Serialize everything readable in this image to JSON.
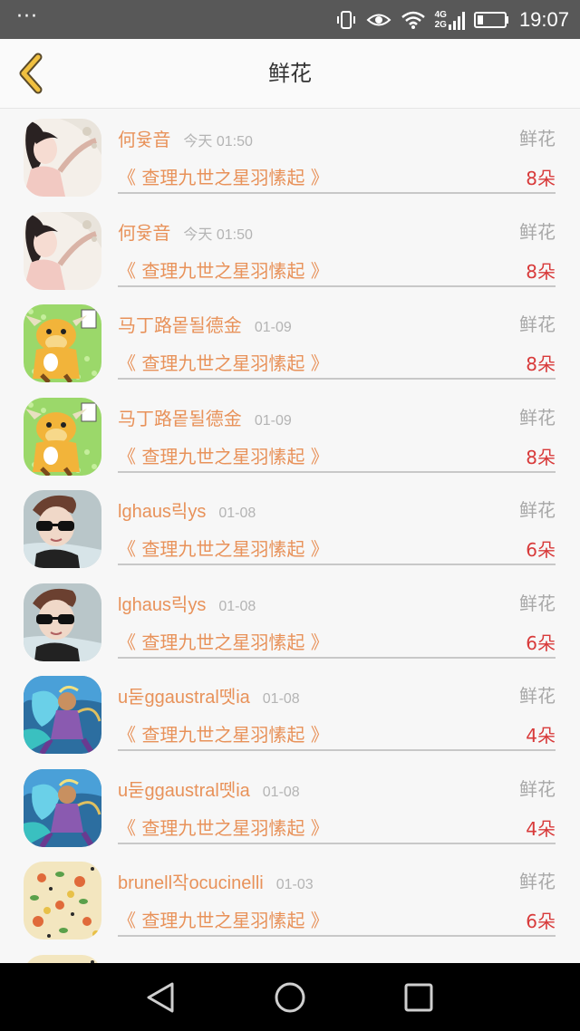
{
  "status_bar": {
    "network": "4G\n2G",
    "time": "19:07"
  },
  "header": {
    "title": "鲜花"
  },
  "items": [
    {
      "name": "何윷音",
      "time": "今天 01:50",
      "category": "鲜花",
      "book": "《 查理九世之星羽愫起 》",
      "count": "8朵",
      "avatar_style": "girl"
    },
    {
      "name": "何윷音",
      "time": "今天 01:50",
      "category": "鲜花",
      "book": "《 查理九世之星羽愫起 》",
      "count": "8朵",
      "avatar_style": "girl"
    },
    {
      "name": "马丁路뫁될德金",
      "time": "01-09",
      "category": "鲜花",
      "book": "《 查理九世之星羽愫起 》",
      "count": "8朵",
      "avatar_style": "bull"
    },
    {
      "name": "马丁路뫁될德金",
      "time": "01-09",
      "category": "鲜花",
      "book": "《 查理九世之星羽愫起 》",
      "count": "8朵",
      "avatar_style": "bull"
    },
    {
      "name": "lghaus릭ys",
      "time": "01-08",
      "category": "鲜花",
      "book": "《 查理九世之星羽愫起 》",
      "count": "6朵",
      "avatar_style": "boy"
    },
    {
      "name": "lghaus릭ys",
      "time": "01-08",
      "category": "鲜花",
      "book": "《 查理九世之星羽愫起 》",
      "count": "6朵",
      "avatar_style": "boy"
    },
    {
      "name": "u둗ggaustral뗏ia",
      "time": "01-08",
      "category": "鲜花",
      "book": "《 查理九世之星羽愫起 》",
      "count": "4朵",
      "avatar_style": "hero"
    },
    {
      "name": "u둗ggaustral뗏ia",
      "time": "01-08",
      "category": "鲜花",
      "book": "《 查理九世之星羽愫起 》",
      "count": "4朵",
      "avatar_style": "hero"
    },
    {
      "name": "brunell작ocucinelli",
      "time": "01-03",
      "category": "鲜花",
      "book": "《 查理九世之星羽愫起 》",
      "count": "6朵",
      "avatar_style": "pizza"
    },
    {
      "name": "",
      "time": "",
      "category": "",
      "book": "",
      "count": "",
      "avatar_style": "pizza"
    }
  ],
  "colors": {
    "accent_orange": "#e8925a",
    "count_red": "#d83a3a",
    "back_arrow": "#e0b030"
  },
  "icons": [
    "back-arrow-icon",
    "vibrate-icon",
    "eye-icon",
    "wifi-icon",
    "signal-icon",
    "battery-icon",
    "nav-back-icon",
    "nav-home-icon",
    "nav-recents-icon"
  ]
}
